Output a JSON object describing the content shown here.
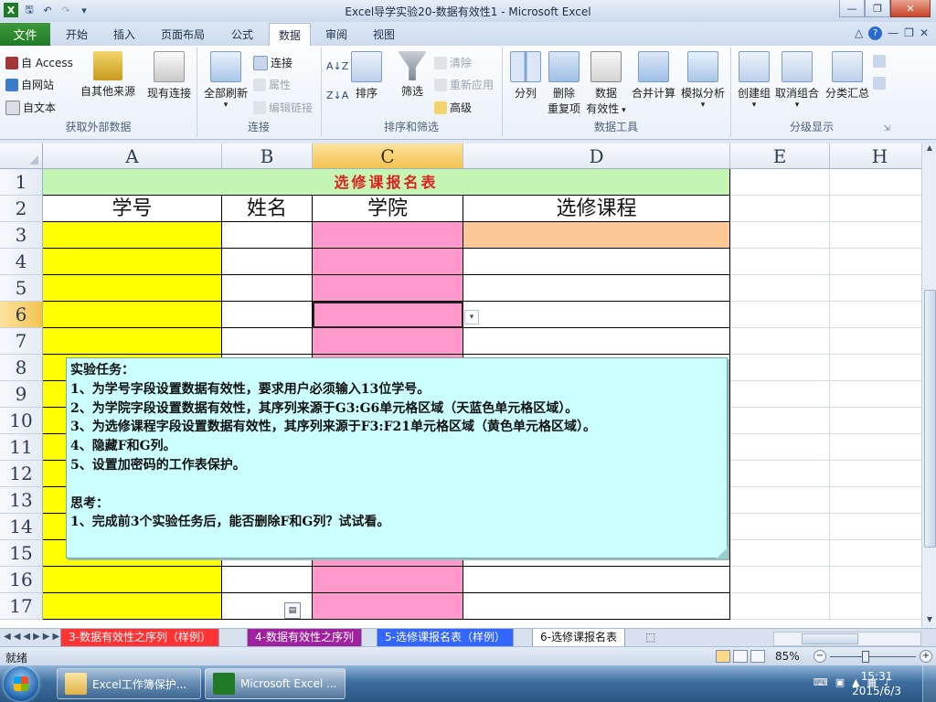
{
  "window": {
    "title": "Excel导学实验20-数据有效性1 - Microsoft Excel"
  },
  "ribbon_tabs": {
    "file": "文件",
    "home": "开始",
    "insert": "插入",
    "page_layout": "页面布局",
    "formulas": "公式",
    "data": "数据",
    "review": "审阅",
    "view": "视图"
  },
  "ribbon": {
    "external": {
      "access": "自 Access",
      "web": "自网站",
      "text": "自文本",
      "other": "自其他来源",
      "existing": "现有连接",
      "label": "获取外部数据"
    },
    "connections": {
      "refresh_all": "全部刷新",
      "connections": "连接",
      "properties": "属性",
      "edit_links": "编辑链接",
      "label": "连接"
    },
    "sort_filter": {
      "sort": "排序",
      "filter": "筛选",
      "clear": "清除",
      "reapply": "重新应用",
      "advanced": "高级",
      "label": "排序和筛选"
    },
    "data_tools": {
      "split": "分列",
      "remove_dup_1": "删除",
      "remove_dup_2": "重复项",
      "validation_1": "数据",
      "validation_2": "有效性",
      "consolidate": "合并计算",
      "what_if": "模拟分析",
      "label": "数据工具"
    },
    "outline": {
      "group": "创建组",
      "ungroup": "取消组合",
      "subtotal": "分类汇总",
      "label": "分级显示"
    }
  },
  "sheet": {
    "columns": [
      "A",
      "B",
      "C",
      "D",
      "E",
      "H"
    ],
    "rows": [
      "1",
      "2",
      "3",
      "4",
      "5",
      "6",
      "7",
      "8",
      "9",
      "10",
      "11",
      "12",
      "13",
      "14",
      "15",
      "16",
      "17"
    ],
    "title": "选修课报名表",
    "headers": [
      "学号",
      "姓名",
      "学院",
      "选修课程"
    ],
    "active_cell": "C6"
  },
  "note": {
    "lines": [
      "实验任务：",
      "1、为学号字段设置数据有效性，要求用户必须输入13位学号。",
      "2、为学院字段设置数据有效性，其序列来源于G3:G6单元格区域（天蓝色单元格区域）。",
      "3、为选修课程字段设置数据有效性，其序列来源于F3:F21单元格区域（黄色单元格区域）。",
      "4、隐藏F和G列。",
      "5、设置加密码的工作表保护。",
      "",
      "思考：",
      "1、完成前3个实验任务后，能否删除F和G列？试试看。"
    ]
  },
  "sheet_tabs": [
    "3-数据有效性之序列（样例）",
    "4-数据有效性之序列",
    "5-选修课报名表（样例）",
    "6-选修课报名表"
  ],
  "status": {
    "ready": "就绪",
    "zoom": "85%"
  },
  "taskbar": {
    "item1": "Excel工作簿保护...",
    "item2": "Microsoft Excel ...",
    "time": "15:31",
    "date": "2015/6/3"
  },
  "colors": {
    "yellow": "#ffff00",
    "pink": "#ff99cc",
    "orange": "#fbc896",
    "title_bg": "#c5f5b3",
    "title_text": "#e02020",
    "note_bg": "#ccffff",
    "excel_green": "#1f7a25"
  }
}
